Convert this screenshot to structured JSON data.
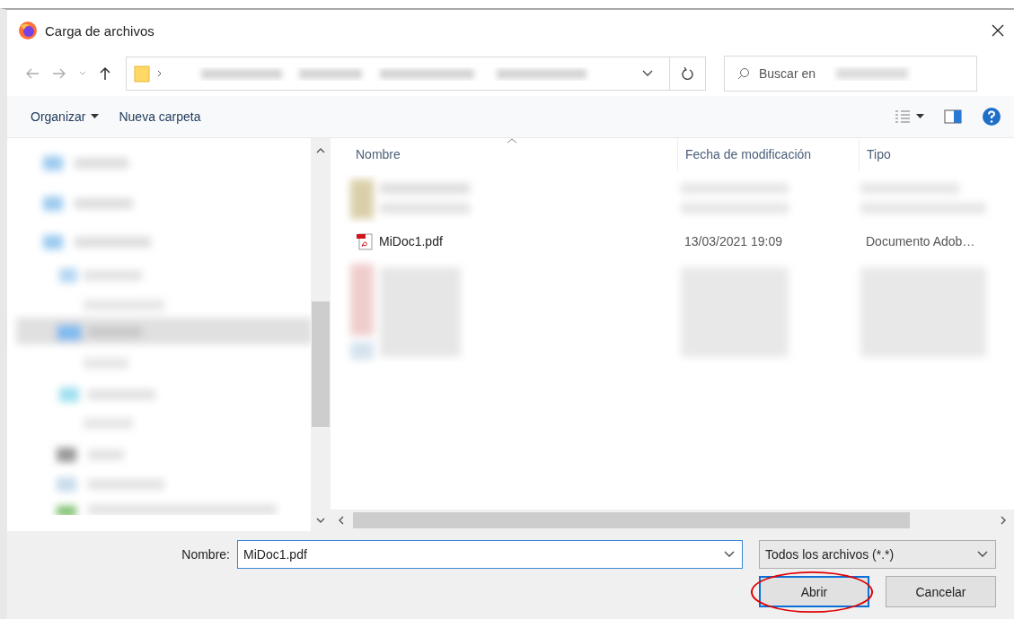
{
  "window": {
    "title": "Carga de archivos"
  },
  "search": {
    "placeholder": "Buscar en"
  },
  "toolbar": {
    "items": [
      "Organizar",
      "Nueva carpeta"
    ]
  },
  "file_list": {
    "columns": [
      "Nombre",
      "Fecha de modificación",
      "Tipo"
    ],
    "rows": [
      {
        "name": "MiDoc1.pdf",
        "modified": "13/03/2021 19:09",
        "type": "Documento Adob…"
      }
    ]
  },
  "footer": {
    "label": "Nombre:",
    "value": "MiDoc1.pdf",
    "filter": "Todos los archivos (*.*)",
    "buttons": [
      {
        "label": "Abrir",
        "default": true,
        "circled": true
      },
      {
        "label": "Cancelar",
        "default": false,
        "circled": false
      }
    ]
  }
}
